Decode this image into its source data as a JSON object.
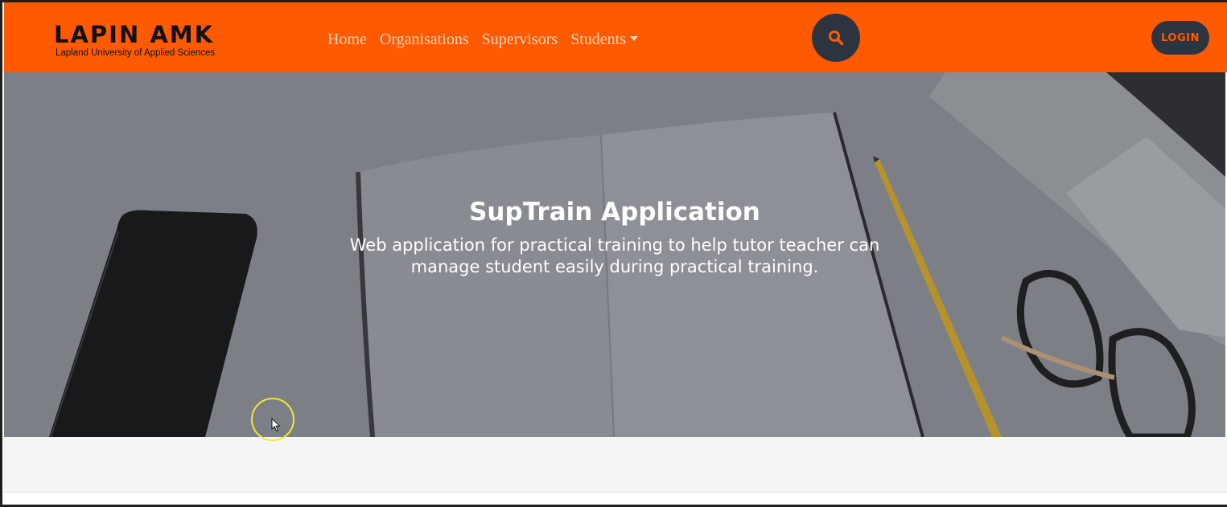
{
  "header": {
    "logo": {
      "name": "LAPIN AMK",
      "subtitle": "Lapland University of Applied Sciences"
    },
    "nav": {
      "home": "Home",
      "organisations": "Organisations",
      "supervisors": "Supervisors",
      "students": "Students"
    },
    "search_icon": "search-icon",
    "login_label": "LOGIN"
  },
  "hero": {
    "title": "SupTrain Application",
    "subtitle": "Web application for practical training to help tutor teacher can manage student easily during practical training."
  },
  "colors": {
    "brand_orange": "#ff5a00",
    "dark_button": "#2c3440",
    "nav_text": "#ffd6bd"
  }
}
